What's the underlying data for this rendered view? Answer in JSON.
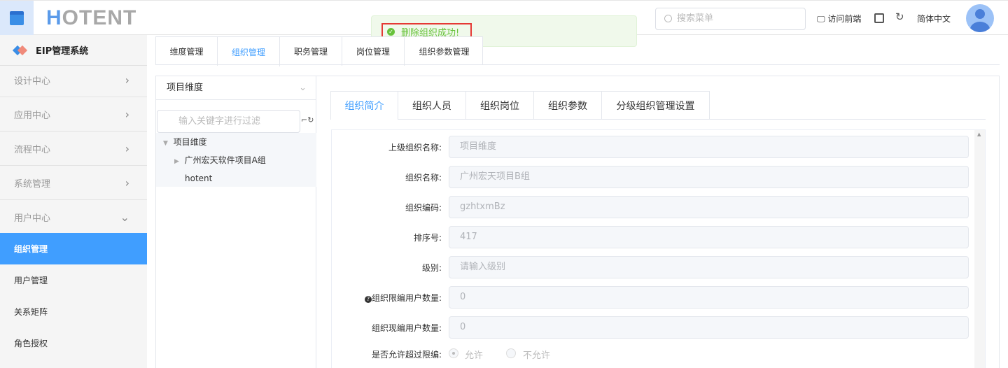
{
  "header": {
    "logo": "HOTENT",
    "search_placeholder": "搜索菜单",
    "visit_front": "访问前端",
    "language": "简体中文"
  },
  "toast": {
    "message": "删除组织成功!",
    "color": "#67c23a"
  },
  "sidebar": {
    "title": "EIP管理系统",
    "groups": [
      {
        "label": "设计中心",
        "chevron": "›"
      },
      {
        "label": "应用中心",
        "chevron": "›"
      },
      {
        "label": "流程中心",
        "chevron": "›"
      },
      {
        "label": "系统管理",
        "chevron": "›"
      },
      {
        "label": "用户中心",
        "chevron": "⌄"
      }
    ],
    "items": [
      {
        "label": "组织管理",
        "active": true
      },
      {
        "label": "用户管理"
      },
      {
        "label": "关系矩阵"
      },
      {
        "label": "角色授权"
      }
    ]
  },
  "tabs": [
    "维度管理",
    "组织管理",
    "职务管理",
    "岗位管理",
    "组织参数管理"
  ],
  "tree": {
    "dimension": "项目维度",
    "filter_placeholder": "输入关键字进行过滤",
    "nodes": [
      "项目维度",
      "广州宏天软件项目A组",
      "hotent"
    ]
  },
  "inner_tabs": [
    "组织简介",
    "组织人员",
    "组织岗位",
    "组织参数",
    "分级组织管理设置"
  ],
  "form": {
    "fields": [
      {
        "label": "上级组织名称:",
        "value": "项目维度"
      },
      {
        "label": "组织名称:",
        "value": "广州宏天项目B组"
      },
      {
        "label": "组织编码:",
        "value": "gzhtxmBz"
      },
      {
        "label": "排序号:",
        "value": "417"
      },
      {
        "label": "级别:",
        "value": "请输入级别"
      },
      {
        "label": "组织限编用户数量:",
        "value": "0"
      },
      {
        "label": "组织现编用户数量:",
        "value": "0"
      }
    ],
    "allow_label": "是否允许超过限编:",
    "allow_yes": "允许",
    "allow_no": "不允许"
  }
}
